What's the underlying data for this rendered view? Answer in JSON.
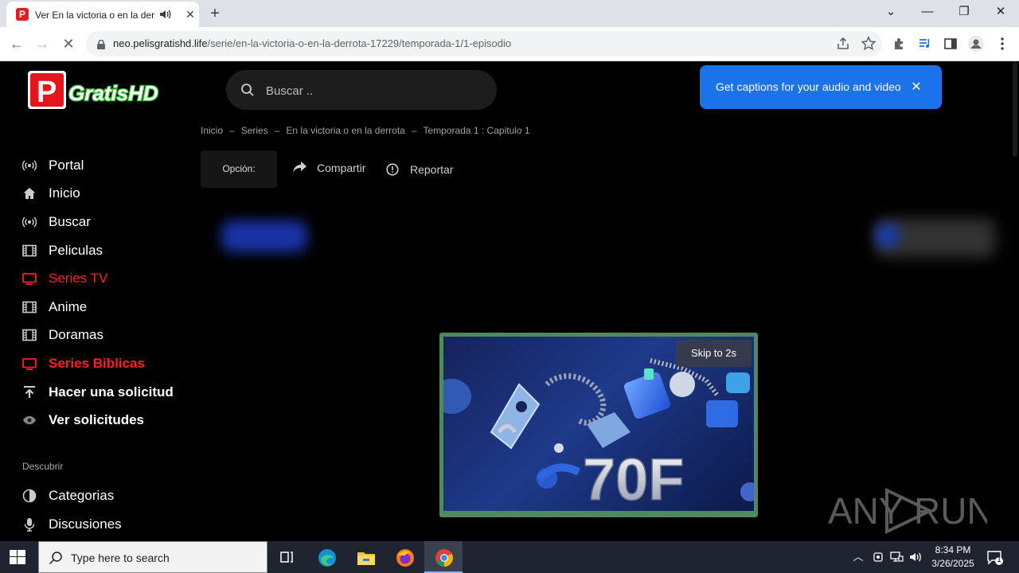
{
  "browser": {
    "tab": {
      "favicon_letter": "P",
      "title": "Ver En la victoria o en la derrota"
    },
    "url": {
      "host": "neo.pelisgratishd.life",
      "path": "/serie/en-la-victoria-o-en-la-derrota-17229/temporada-1/1-episodio"
    }
  },
  "page": {
    "logo": {
      "letter": "P",
      "text": "GratisHD"
    },
    "search": {
      "placeholder": "Buscar .."
    },
    "captions_popup": {
      "text": "Get captions for your audio and video"
    },
    "breadcrumb": [
      "Inicio",
      "Series",
      "En la victoria o en la derrota",
      "Temporada 1 : Capitulo 1"
    ],
    "actions": {
      "option_label": "Opción:",
      "share_label": "Compartir",
      "report_label": "Reportar"
    },
    "sidebar": {
      "items": [
        {
          "label": "Portal",
          "icon": "broadcast-icon",
          "active": false
        },
        {
          "label": "Inicio",
          "icon": "home-icon",
          "active": false
        },
        {
          "label": "Buscar",
          "icon": "broadcast-icon",
          "active": false
        },
        {
          "label": "Peliculas",
          "icon": "film-icon",
          "active": false
        },
        {
          "label": "Series TV",
          "icon": "tv-icon",
          "active": true
        },
        {
          "label": "Anime",
          "icon": "film-icon",
          "active": false
        },
        {
          "label": "Doramas",
          "icon": "film-icon",
          "active": false
        },
        {
          "label": "Series Biblicas",
          "icon": "tv-icon",
          "active": true
        },
        {
          "label": "Hacer una solicitud",
          "icon": "upload-icon",
          "active": false
        },
        {
          "label": "Ver solicitudes",
          "icon": "eye-icon",
          "active": false
        }
      ],
      "discover_heading": "Descubrir",
      "discover_items": [
        {
          "label": "Categorias",
          "icon": "half-circle-icon"
        },
        {
          "label": "Discusiones",
          "icon": "microphone-icon"
        }
      ]
    },
    "ad": {
      "skip_label": "Skip to 2s",
      "banner_text": "70F"
    },
    "watermark": "ANY RUN"
  },
  "taskbar": {
    "search_placeholder": "Type here to search",
    "time": "8:34 PM",
    "date": "3/26/2025",
    "notification_count": "1"
  },
  "colors": {
    "accent_red": "#ff1f1f",
    "captions_blue": "#1a73e8",
    "page_bg": "#000000"
  }
}
